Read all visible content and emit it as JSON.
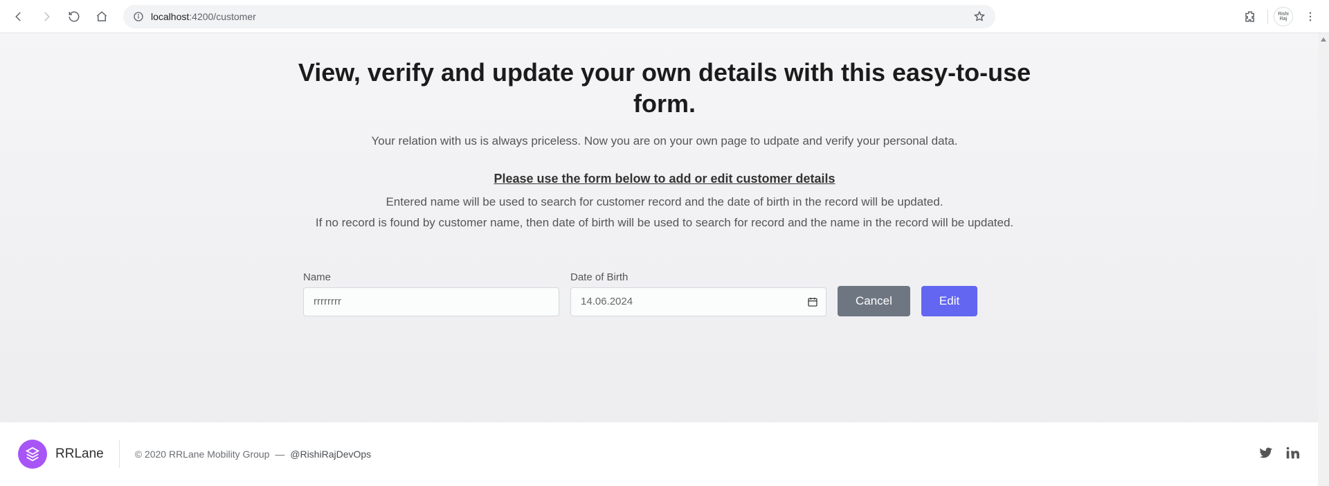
{
  "browser": {
    "url_host": "localhost",
    "url_port_path": ":4200/customer",
    "profile_name": "Rishi Raj"
  },
  "page": {
    "headline": "View, verify and update your own details with this easy-to-use form.",
    "subheadline": "Your relation with us is always priceless. Now you are on your own page to udpate and verify your personal data.",
    "instructions_title": "Please use the form below to add or edit customer details",
    "help1": "Entered name will be used to search for customer record and the date of birth in the record will be updated.",
    "help2": "If no record is found by customer name, then date of birth will be used to search for record and the name in the record will be updated.",
    "form": {
      "name_label": "Name",
      "name_value": "rrrrrrrr",
      "dob_label": "Date of Birth",
      "dob_value": "14.06.2024",
      "cancel_label": "Cancel",
      "edit_label": "Edit"
    }
  },
  "footer": {
    "brand": "RRLane",
    "copyright": "© 2020 RRLane Mobility Group",
    "dash": "—",
    "author": "@RishiRajDevOps"
  }
}
